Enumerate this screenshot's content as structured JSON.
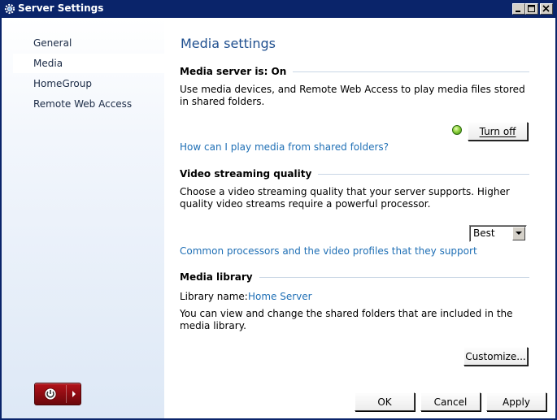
{
  "window": {
    "title": "Server Settings",
    "icon": "gear-icon"
  },
  "sidebar": {
    "items": [
      {
        "label": "General",
        "selected": false
      },
      {
        "label": "Media",
        "selected": true
      },
      {
        "label": "HomeGroup",
        "selected": false
      },
      {
        "label": "Remote Web Access",
        "selected": false
      }
    ],
    "power_icon": "power-icon",
    "power_arrow_icon": "triangle-right-icon"
  },
  "main": {
    "title": "Media settings",
    "media_server": {
      "header": "Media server is: On",
      "description": "Use media devices, and Remote Web Access to play media files stored in shared folders.",
      "status_color": "#8ed13d",
      "turn_off_label": "Turn off",
      "help_link": "How can I play media from shared folders?"
    },
    "video_streaming": {
      "header": "Video streaming quality",
      "description": "Choose a video streaming quality that your server supports. Higher quality video streams require a powerful processor.",
      "quality_selected": "Best",
      "processors_link": "Common processors and the video profiles that they support"
    },
    "media_library": {
      "header": "Media library",
      "library_name_label": "Library name:",
      "library_name_value": "Home Server",
      "description": "You can view and change the shared folders that are included in the media library.",
      "customize_label": "Customize..."
    }
  },
  "footer": {
    "ok_label": "OK",
    "cancel_label": "Cancel",
    "apply_label": "Apply"
  },
  "colors": {
    "titlebar": "#0a246a",
    "link": "#1f6fb5",
    "page_title": "#1f4f8f",
    "power_button": "#8f0c12"
  }
}
